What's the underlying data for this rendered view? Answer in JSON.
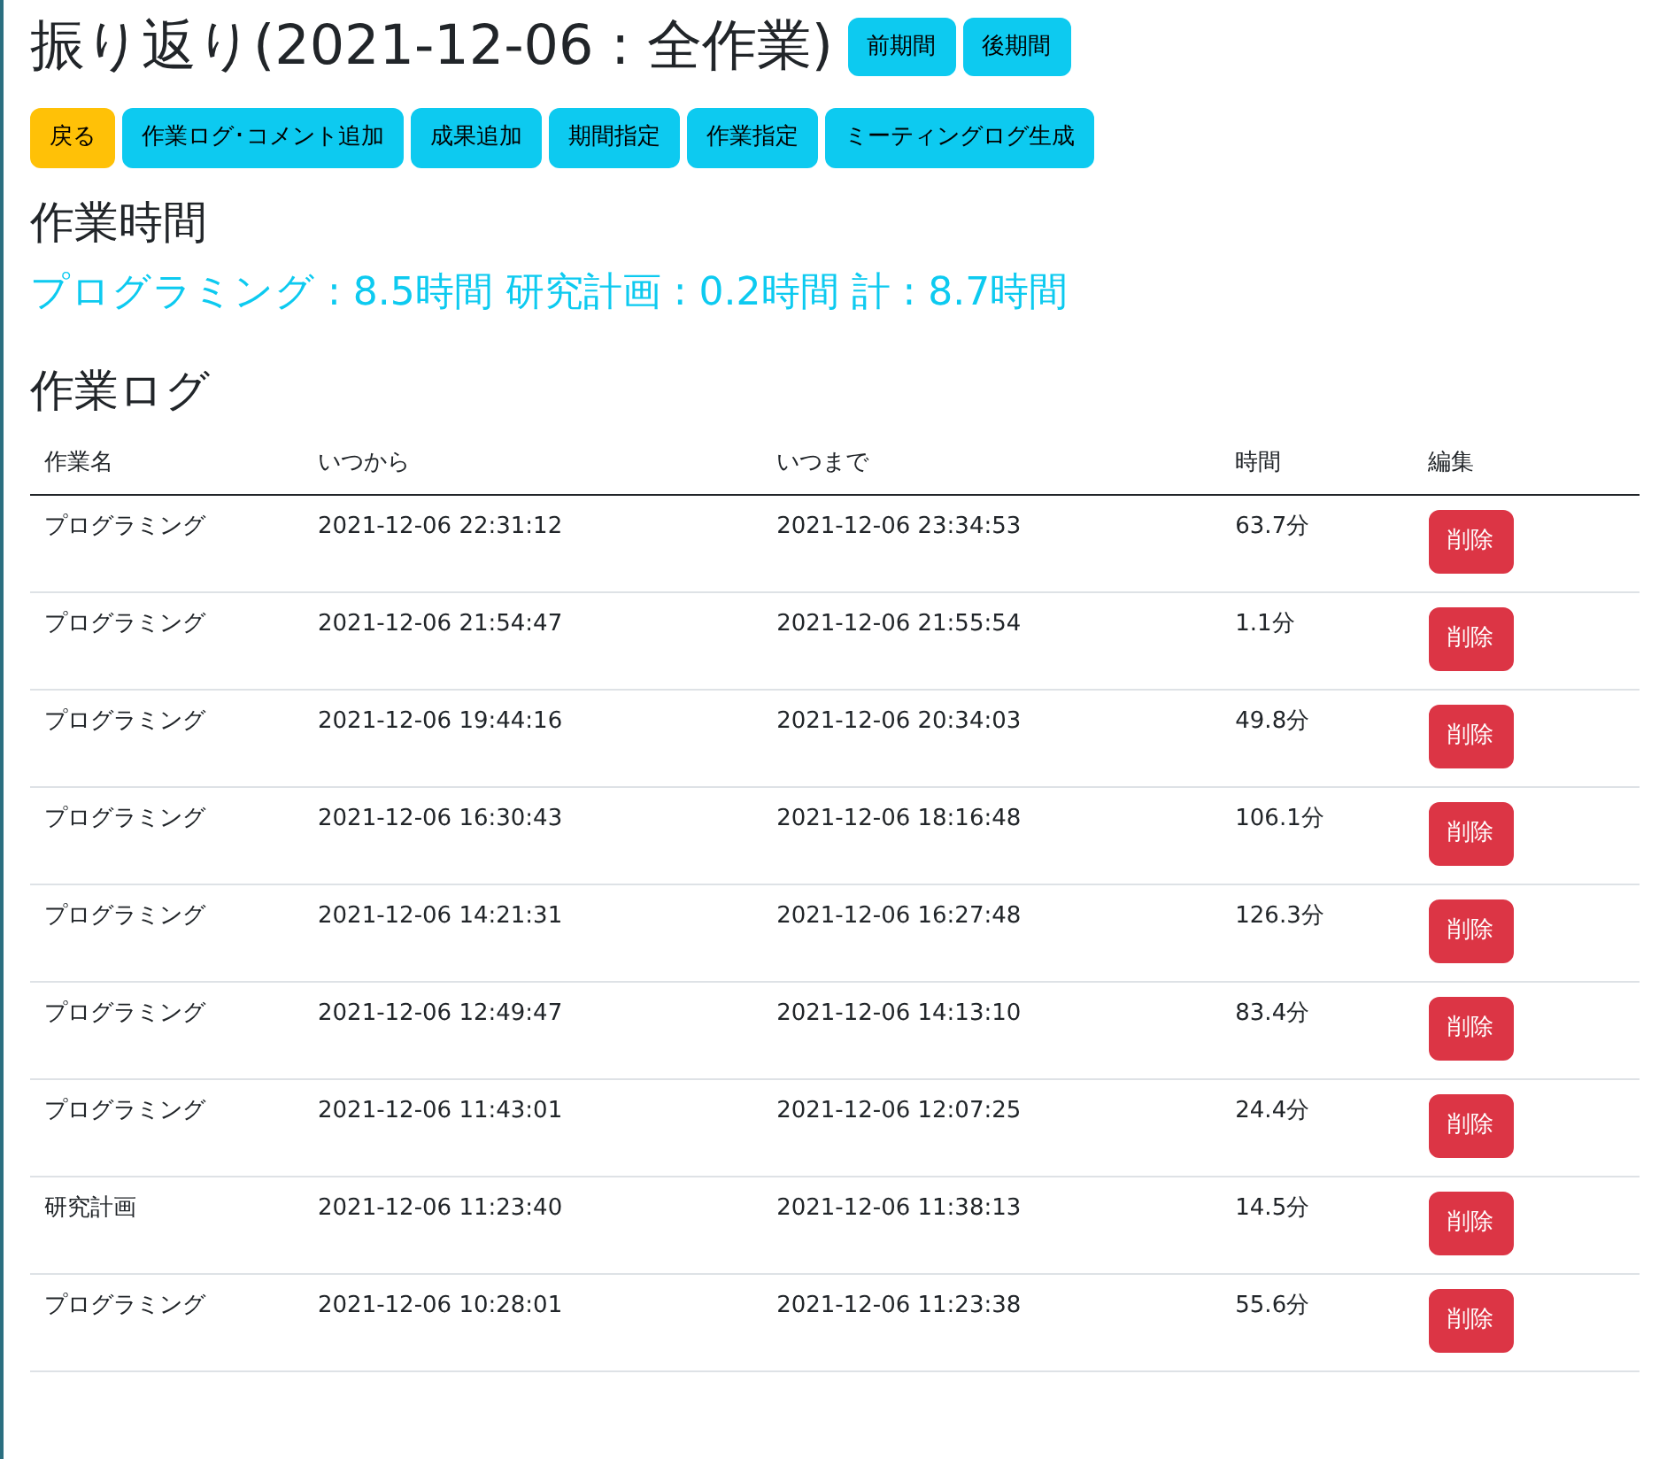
{
  "title": "振り返り(2021-12-06 : 全作業)",
  "period_buttons": [
    "前期間",
    "後期間"
  ],
  "toolbar": [
    {
      "label": "戻る",
      "kind": "warning"
    },
    {
      "label": "作業ログ･コメント追加",
      "kind": "info"
    },
    {
      "label": "成果追加",
      "kind": "info"
    },
    {
      "label": "期間指定",
      "kind": "info"
    },
    {
      "label": "作業指定",
      "kind": "info"
    },
    {
      "label": "ミーティングログ生成",
      "kind": "info"
    }
  ],
  "work_time": {
    "heading": "作業時間",
    "summary": "プログラミング : 8.5時間 研究計画 : 0.2時間 計 : 8.7時間"
  },
  "work_log": {
    "heading": "作業ログ",
    "columns": [
      "作業名",
      "いつから",
      "いつまで",
      "時間",
      "編集"
    ],
    "rows": [
      {
        "task": "プログラミング",
        "from": "2021-12-06 22:31:12",
        "to": "2021-12-06 23:34:53",
        "duration": "63.7分",
        "action": "削除"
      },
      {
        "task": "プログラミング",
        "from": "2021-12-06 21:54:47",
        "to": "2021-12-06 21:55:54",
        "duration": "1.1分",
        "action": "削除"
      },
      {
        "task": "プログラミング",
        "from": "2021-12-06 19:44:16",
        "to": "2021-12-06 20:34:03",
        "duration": "49.8分",
        "action": "削除"
      },
      {
        "task": "プログラミング",
        "from": "2021-12-06 16:30:43",
        "to": "2021-12-06 18:16:48",
        "duration": "106.1分",
        "action": "削除"
      },
      {
        "task": "プログラミング",
        "from": "2021-12-06 14:21:31",
        "to": "2021-12-06 16:27:48",
        "duration": "126.3分",
        "action": "削除"
      },
      {
        "task": "プログラミング",
        "from": "2021-12-06 12:49:47",
        "to": "2021-12-06 14:13:10",
        "duration": "83.4分",
        "action": "削除"
      },
      {
        "task": "プログラミング",
        "from": "2021-12-06 11:43:01",
        "to": "2021-12-06 12:07:25",
        "duration": "24.4分",
        "action": "削除"
      },
      {
        "task": "研究計画",
        "from": "2021-12-06 11:23:40",
        "to": "2021-12-06 11:38:13",
        "duration": "14.5分",
        "action": "削除"
      },
      {
        "task": "プログラミング",
        "from": "2021-12-06 10:28:01",
        "to": "2021-12-06 11:23:38",
        "duration": "55.6分",
        "action": "削除"
      }
    ]
  }
}
